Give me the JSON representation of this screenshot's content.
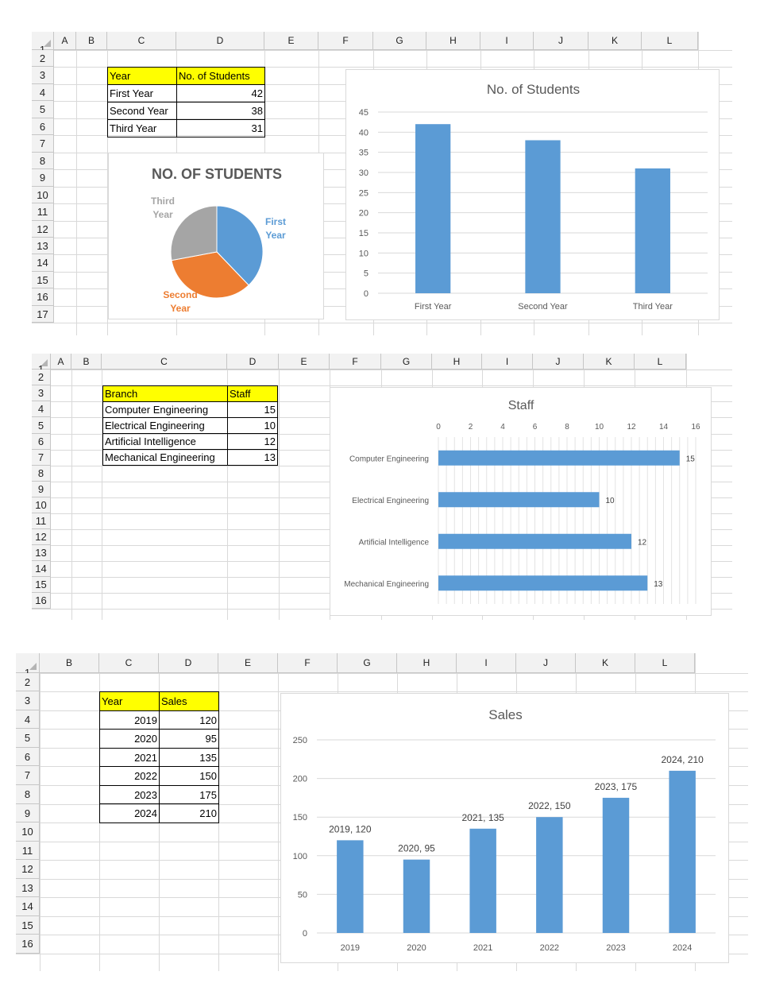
{
  "sheet1": {
    "columns": [
      "A",
      "B",
      "C",
      "D",
      "E",
      "F",
      "G",
      "H",
      "I",
      "J",
      "K",
      "L"
    ],
    "rows": [
      "1",
      "2",
      "3",
      "4",
      "5",
      "6",
      "7",
      "8",
      "9",
      "10",
      "11",
      "12",
      "13",
      "14",
      "15",
      "16",
      "17"
    ],
    "table": {
      "headers": [
        "Year",
        "No. of Students"
      ],
      "rows": [
        [
          "First Year",
          "42"
        ],
        [
          "Second Year",
          "38"
        ],
        [
          "Third Year",
          "31"
        ]
      ]
    },
    "pie_chart": {
      "chart_data": {
        "type": "pie",
        "title": "NO. OF STUDENTS",
        "categories": [
          "First Year",
          "Second Year",
          "Third Year"
        ],
        "values": [
          42,
          38,
          31
        ],
        "colors": [
          "#5b9bd5",
          "#ed7d31",
          "#a5a5a5"
        ],
        "labels": [
          [
            "First",
            "Year"
          ],
          [
            "Second",
            "Year"
          ],
          [
            "Third",
            "Year"
          ]
        ],
        "legend": "none"
      }
    },
    "bar_chart": {
      "chart_data": {
        "type": "bar",
        "title": "No. of Students",
        "categories": [
          "First Year",
          "Second Year",
          "Third Year"
        ],
        "values": [
          42,
          38,
          31
        ],
        "ylim": [
          0,
          45
        ],
        "yticks": [
          "0",
          "5",
          "10",
          "15",
          "20",
          "25",
          "30",
          "35",
          "40",
          "45"
        ],
        "color": "#5b9bd5",
        "grid": true
      }
    }
  },
  "sheet2": {
    "columns": [
      "A",
      "B",
      "C",
      "D",
      "E",
      "F",
      "G",
      "H",
      "I",
      "J",
      "K",
      "L"
    ],
    "rows": [
      "1",
      "2",
      "3",
      "4",
      "5",
      "6",
      "7",
      "8",
      "9",
      "10",
      "11",
      "12",
      "13",
      "14",
      "15",
      "16"
    ],
    "table": {
      "headers": [
        "Branch",
        "Staff"
      ],
      "rows": [
        [
          "Computer Engineering",
          "15"
        ],
        [
          "Electrical Engineering",
          "10"
        ],
        [
          "Artificial Intelligence",
          "12"
        ],
        [
          "Mechanical Engineering",
          "13"
        ]
      ]
    },
    "bar_chart": {
      "chart_data": {
        "type": "bar",
        "orientation": "horizontal",
        "title": "Staff",
        "categories": [
          "Computer Engineering",
          "Electrical Engineering",
          "Artificial Intelligence",
          "Mechanical Engineering"
        ],
        "values": [
          15,
          10,
          12,
          13
        ],
        "xlim": [
          0,
          16
        ],
        "xticks": [
          "0",
          "2",
          "4",
          "6",
          "8",
          "10",
          "12",
          "14",
          "16"
        ],
        "data_labels": [
          "15",
          "10",
          "12",
          "13"
        ],
        "color": "#5b9bd5",
        "grid": true
      }
    }
  },
  "sheet3": {
    "columns": [
      "A",
      "B",
      "C",
      "D",
      "E",
      "F",
      "G",
      "H",
      "I",
      "J",
      "K",
      "L"
    ],
    "rows": [
      "1",
      "2",
      "3",
      "4",
      "5",
      "6",
      "7",
      "8",
      "9",
      "10",
      "11",
      "12",
      "13",
      "14",
      "15",
      "16"
    ],
    "table": {
      "headers": [
        "Year",
        "Sales"
      ],
      "rows": [
        [
          "2019",
          "120"
        ],
        [
          "2020",
          "95"
        ],
        [
          "2021",
          "135"
        ],
        [
          "2022",
          "150"
        ],
        [
          "2023",
          "175"
        ],
        [
          "2024",
          "210"
        ]
      ]
    },
    "bar_chart": {
      "chart_data": {
        "type": "bar",
        "title": "Sales",
        "categories": [
          "2019",
          "2020",
          "2021",
          "2022",
          "2023",
          "2024"
        ],
        "values": [
          120,
          95,
          135,
          150,
          175,
          210
        ],
        "ylim": [
          0,
          250
        ],
        "yticks": [
          "0",
          "50",
          "100",
          "150",
          "200",
          "250"
        ],
        "data_labels": [
          "2019, 120",
          "2020, 95",
          "2021, 135",
          "2022, 150",
          "2023, 175",
          "2024, 210"
        ],
        "color": "#5b9bd5",
        "grid": true
      }
    }
  }
}
